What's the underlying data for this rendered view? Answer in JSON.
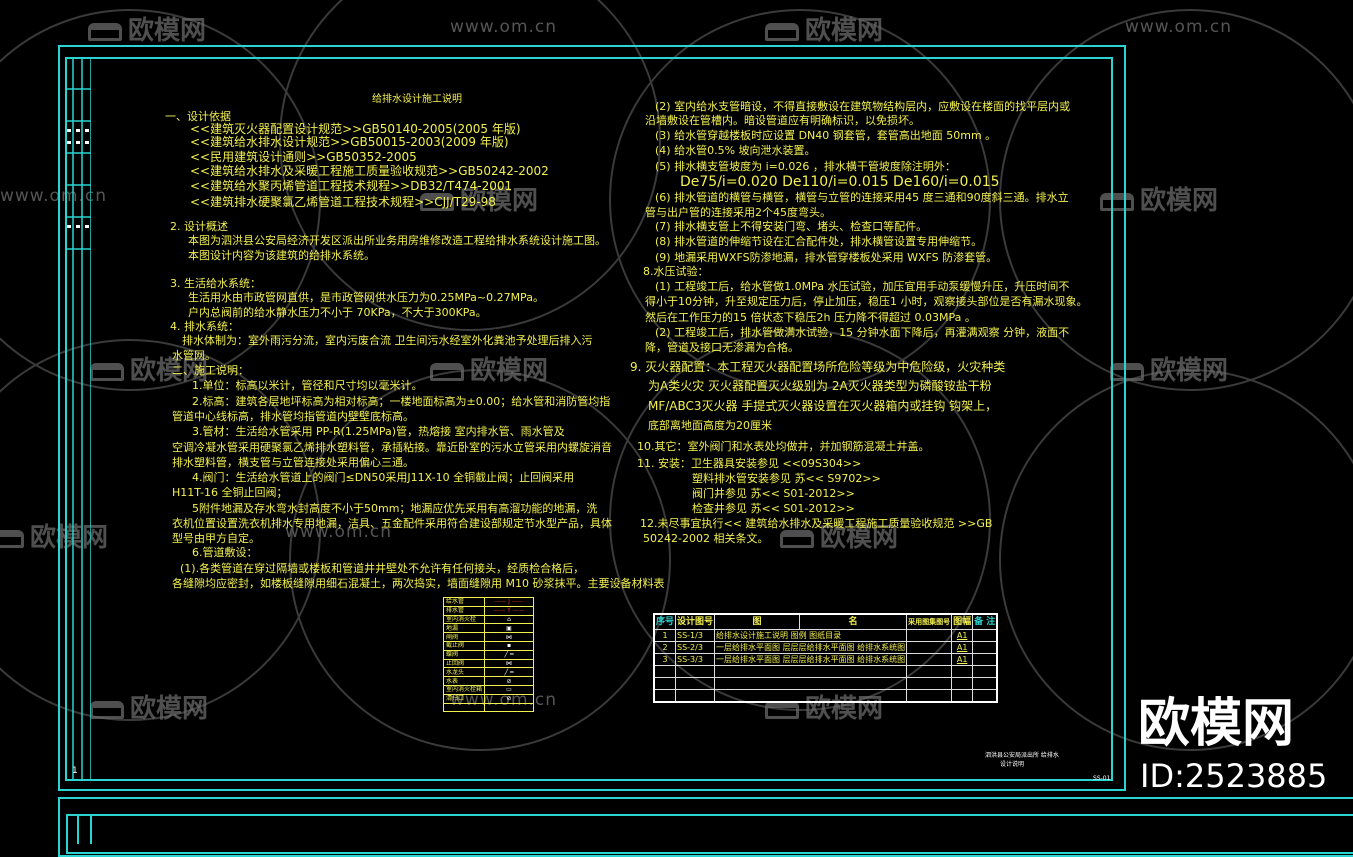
{
  "drawing_title": "给排水设计施工说明",
  "notes": {
    "left": [
      "一、设计依据",
      "<<建筑灭火器配置设计规范>>GB50140-2005(2005 年版)",
      "<<建筑给水排水设计规范>>GB50015-2003(2009 年版)",
      "<<民用建筑设计通则>>GB50352-2005",
      "<<建筑给水排水及采暖工程施工质量验收规范>>GB50242-2002",
      "<<建筑给水聚丙烯管道工程技术规程>>DB32/T474-2001",
      "<<建筑排水硬聚氯乙烯管道工程技术规程>>CJJ/T29-98",
      "2. 设计概述",
      "本图为泗洪县公安局经济开发区派出所业务用房维修改造工程给排水系统设计施工图。",
      "本图设计内容为该建筑的给排水系统。",
      "3. 生活给水系统：",
      "生活用水由市政管网直供，是市政管网供水压力为0.25MPa~0.27MPa。",
      "户内总阀前的给水静水压力不小于 70KPa，不大于300KPa。",
      "4. 排水系统：",
      "排水体制为：室外雨污分流，室内污废合流 卫生间污水经室外化粪池予处理后排入污",
      "水管网。",
      "二、施工说明：",
      "1.单位：标高以米计，管径和尺寸均以毫米计。",
      "2.标高：建筑各层地坪标高为相对标高；一楼地面标高为±0.00；给水管和消防管均指",
      "管道中心线标高，排水管均指管道内壁壁底标高。",
      "3.管材：生活给水管采用 PP-R(1.25MPa)管，热熔接 室内排水管、雨水管及",
      "空调冷凝水管采用硬聚氯乙烯排水塑料管，承插粘接。靠近卧室的污水立管采用内螺旋消音",
      "排水塑料管，横支管与立管连接处采用偏心三通。",
      "4.阀门：生活给水管道上的阀门≤DN50采用J11X-10 全铜截止阀；止回阀采用",
      "H11T-16 全铜止回阀；",
      "5附件地漏及存水弯水封高度不小于50mm；地漏应优先采用有高溜功能的地漏，洗",
      "衣机位置设置洗衣机排水专用地漏，洁具、五金配件采用符合建设部规定节水型产品，具体",
      "型号由甲方自定。",
      "6.管道敷设：",
      "(1).各类管道在穿过隔墙或楼板和管道井井壁处不允许有任何接头，经质检合格后，",
      "各缝隙均应密封，如楼板缝隙用细石混凝土，两次捣实，墙面缝隙用 M10 砂浆抹平。主要设备材料表"
    ],
    "right": [
      "(2) 室内给水支管暗设，不得直接敷设在建筑物结构层内，应敷设在楼面的找平层内或",
      "沿墙敷设在管槽内。暗设管道应有明确标识，以免损坏。",
      "(3) 给水管穿越楼板时应设置 DN40 钢套管，套管高出地面  50mm  。",
      "(4) 给水管0.5% 坡向泄水装置。",
      "(5) 排水横支管坡度为 i=0.026 ，排水横干管坡度除注明外：",
      "De75/i=0.020   De110/i=0.015   De160/i=0.015",
      "(6) 排水管道的横管与横管，横管与立管的连接采用45 度三通和90度斜三通。排水立",
      "管与出户管的连接采用2个45度弯头。",
      "(7) 排水横支管上不得安装门弯、堵头、检查口等配件。",
      "(8) 排水管道的伸缩节设在汇合配件处，排水横管设置专用伸缩节。",
      "(9) 地漏采用WXFS防渗地漏，排水管穿楼板处采用 WXFS 防渗套管。",
      "8.水压试验：",
      "(1) 工程竣工后，给水管做1.0MPa 水压试验，加压宜用手动泵缓慢升压，升压时间不",
      "得小于10分钟，升至规定压力后，停止加压，稳压1 小时，观察接头部位是否有漏水现象。",
      "然后在工作压力的15 倍状态下稳压2h 压力降不得超过 0.03MPa 。",
      "(2) 工程竣工后，排水管做满水试验，15 分钟水面下降后，再灌满观察  分钟，液面不",
      "降，管道及接口无渗漏为合格。",
      "9. 灭火器配置：本工程灭火器配置场所危险等级为中危险级，火灾种类",
      "为A类火灾 灭火器配置灭火级别为  2A灭火器类型为磷酸铵盐干粉",
      "MF/ABC3灭火器 手提式灭火器设置在灭火器箱内或挂钩 钩架上，",
      "底部离地面高度为20厘米",
      "10.其它：室外阀门和水表处均做井，并加钢筋混凝土井盖。",
      "11. 安装：卫生器具安装参见   <<09S304>>",
      "塑料排水管安装参见 苏<< S9702>>",
      "阀门井参见 苏<<  S01-2012>>",
      "检查井参见 苏<<  S01-2012>>",
      "12.未尽事宜执行<< 建筑给水排水及采暖工程施工质量验收规范 >>GB",
      "50242-2002 相关条文。"
    ]
  },
  "drawing_list": {
    "headers": [
      "序号",
      "设计图号",
      "图",
      "名",
      "采用图集图号",
      "图幅",
      "备 注"
    ],
    "rows": [
      {
        "no": "1",
        "code": "SS-1/3",
        "name": "给排水设计施工说明  图例  图纸目录",
        "atlas": "",
        "size": "A1",
        "remark": ""
      },
      {
        "no": "2",
        "code": "SS-2/3",
        "name": "一层给排水平面图   层层层给排水平面图  给排水系统图",
        "atlas": "",
        "size": "A1",
        "remark": ""
      },
      {
        "no": "3",
        "code": "SS-3/3",
        "name": "一层给排水平面图   层层层给排水平面图  给排水系统图",
        "atlas": "",
        "size": "A1",
        "remark": ""
      }
    ]
  },
  "legend": {
    "rows": [
      {
        "label": "给水管",
        "symbol": "—— J ——"
      },
      {
        "label": "排水管",
        "symbol": "—— Y ——"
      },
      {
        "label": "室内消火栓",
        "symbol": "⌂"
      },
      {
        "label": "地漏",
        "symbol": "▣"
      },
      {
        "label": "闸阀",
        "symbol": "⋈"
      },
      {
        "label": "截止阀",
        "symbol": "▪"
      },
      {
        "label": "蝶阀",
        "symbol": "╱ ━"
      },
      {
        "label": "止回阀",
        "symbol": "⋈"
      },
      {
        "label": "水龙头",
        "symbol": "╱ ━"
      },
      {
        "label": "水表",
        "symbol": "⊘"
      },
      {
        "label": "室内消火栓箱",
        "symbol": "▭"
      },
      {
        "label": "清扫口",
        "symbol": "⊘"
      },
      {
        "label": "",
        "symbol": ""
      }
    ]
  },
  "title_block": {
    "project": "泗洪县公安局派出所 给排水",
    "sub": "设计说明",
    "sheet_no": "SS-01",
    "page": "1"
  },
  "watermark": {
    "brand": "欧模网",
    "url": "www.om.cn",
    "id": "ID:2523885"
  },
  "colors": {
    "frame": "#2ad4d0",
    "text": "#f2f050",
    "background": "#000000"
  }
}
